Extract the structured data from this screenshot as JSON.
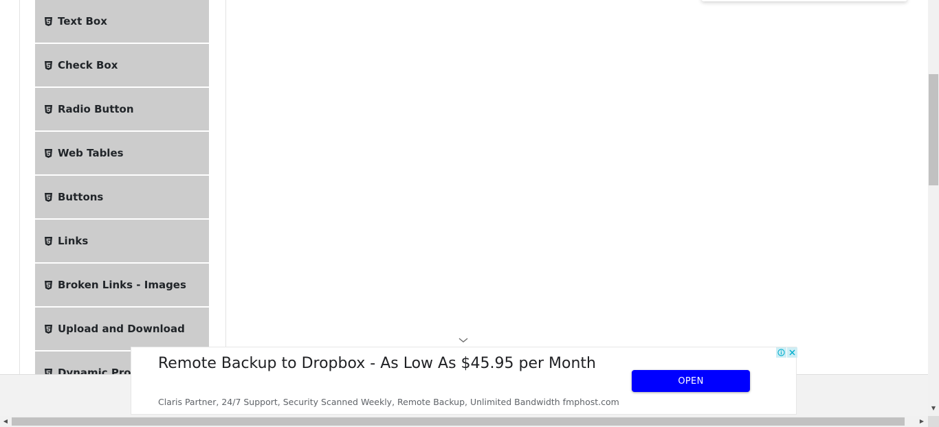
{
  "sidebar": {
    "items": [
      {
        "label": "Text Box",
        "icon": "html5-icon"
      },
      {
        "label": "Check Box",
        "icon": "html5-icon"
      },
      {
        "label": "Radio Button",
        "icon": "html5-icon"
      },
      {
        "label": "Web Tables",
        "icon": "html5-icon"
      },
      {
        "label": "Buttons",
        "icon": "html5-icon"
      },
      {
        "label": "Links",
        "icon": "html5-icon"
      },
      {
        "label": "Broken Links - Images",
        "icon": "html5-icon"
      },
      {
        "label": "Upload and Download",
        "icon": "html5-icon"
      },
      {
        "label": "Dynamic Prop",
        "icon": "html5-icon"
      }
    ]
  },
  "ad": {
    "headline": "Remote Backup to Dropbox - As Low As $45.95 per Month",
    "description": "Claris Partner, 24/7 Support, Security Scanned Weekly, Remote Backup, Unlimited Bandwidth fmphost.com",
    "button_label": "OPEN",
    "button_color": "#0000ff",
    "icons": [
      "info-icon",
      "close-icon",
      "chevron-down-icon"
    ]
  },
  "colors": {
    "menu_bg": "#cccccc",
    "menu_text": "#212529",
    "scrollbar_thumb": "#c1c1c1"
  }
}
